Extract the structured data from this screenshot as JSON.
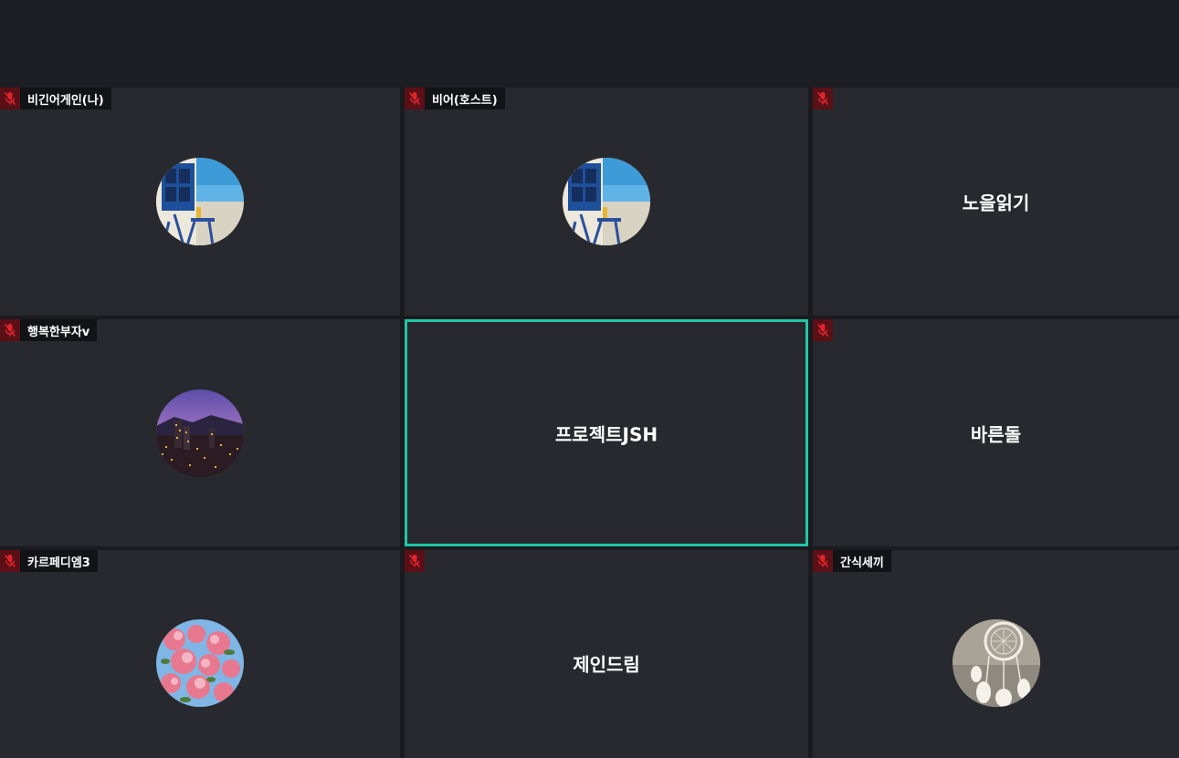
{
  "participants": [
    {
      "name": "비긴어게인(나)",
      "muted": true,
      "avatar": "blue-window-balcony",
      "display_name": ""
    },
    {
      "name": "비어(호스트)",
      "muted": true,
      "avatar": "blue-window-balcony",
      "display_name": ""
    },
    {
      "name": "",
      "muted": true,
      "avatar": "",
      "display_name": "노을읽기"
    },
    {
      "name": "행복한부자v",
      "muted": true,
      "avatar": "night-city",
      "display_name": ""
    },
    {
      "name": "",
      "muted": false,
      "avatar": "",
      "display_name": "프로젝트JSH",
      "speaking": true
    },
    {
      "name": "",
      "muted": true,
      "avatar": "",
      "display_name": "바른돌"
    },
    {
      "name": "카르페디엠3",
      "muted": true,
      "avatar": "pink-blossoms",
      "display_name": ""
    },
    {
      "name": "",
      "muted": true,
      "avatar": "",
      "display_name": "제인드림"
    },
    {
      "name": "간식세끼",
      "muted": true,
      "avatar": "dreamcatcher",
      "display_name": ""
    }
  ],
  "colors": {
    "speaking_border": "#1fc7a6",
    "tile_bg": "#28292e",
    "mic_bg": "#5a1016",
    "mic_icon": "#e0242f"
  }
}
